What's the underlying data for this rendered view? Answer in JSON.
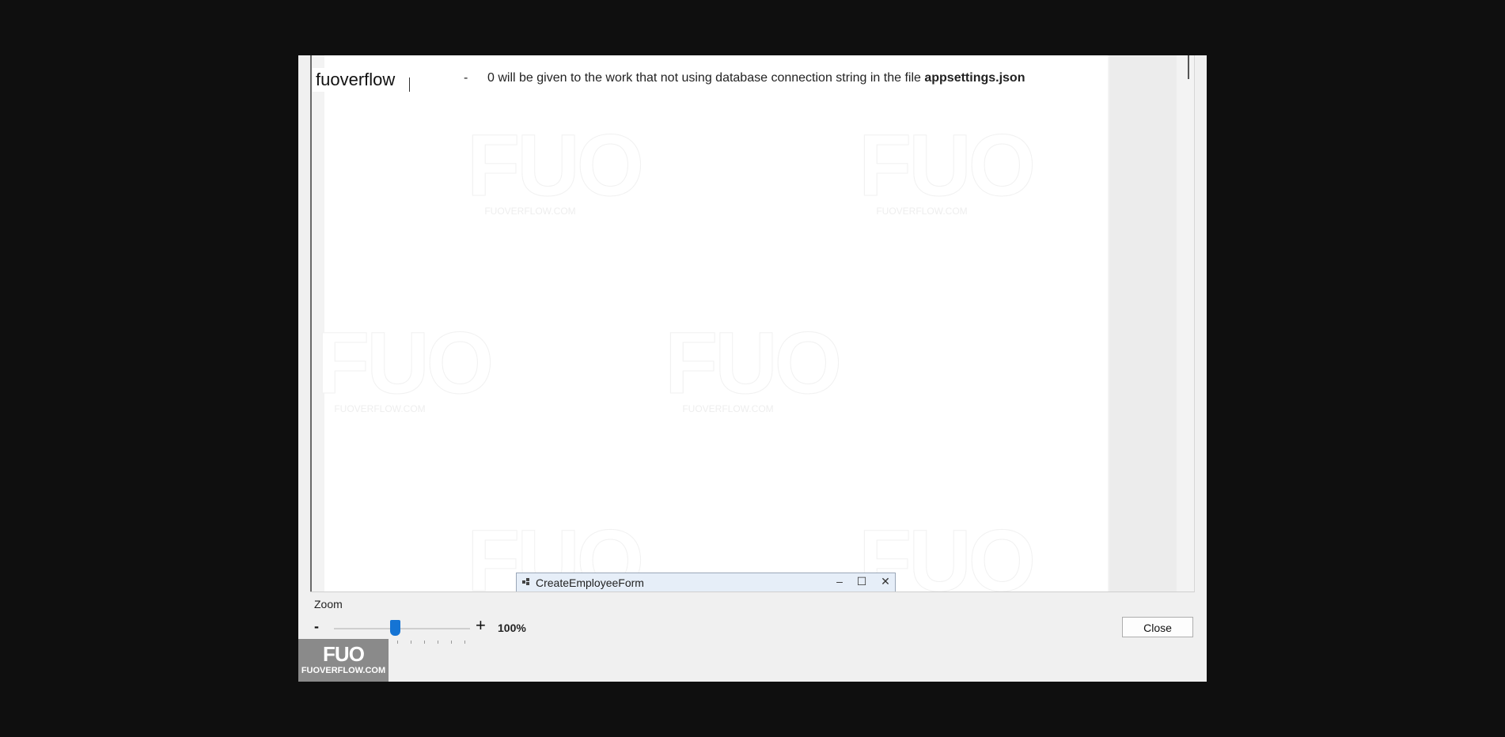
{
  "viewer": {
    "brand_label": "fuoverflow",
    "bullet": "-",
    "instruction_text": "0 will be given to the work that not using database connection string in the file",
    "instruction_bold": "appsettings.json",
    "watermark_logo": "FUO",
    "watermark_site": "FUOVERFLOW.COM"
  },
  "mini_window": {
    "title": "CreateEmployeeForm",
    "minimize": "–",
    "maximize": "☐",
    "close": "✕"
  },
  "zoom": {
    "label": "Zoom",
    "minus": "-",
    "plus": "+",
    "value": "100%",
    "slider_fraction": 0.45
  },
  "buttons": {
    "close": "Close"
  },
  "badge": {
    "logo": "FUO",
    "site": "FUOVERFLOW.COM"
  },
  "colors": {
    "accent": "#1574d4",
    "background": "#0f0f0f",
    "window": "#f0f0f0"
  }
}
